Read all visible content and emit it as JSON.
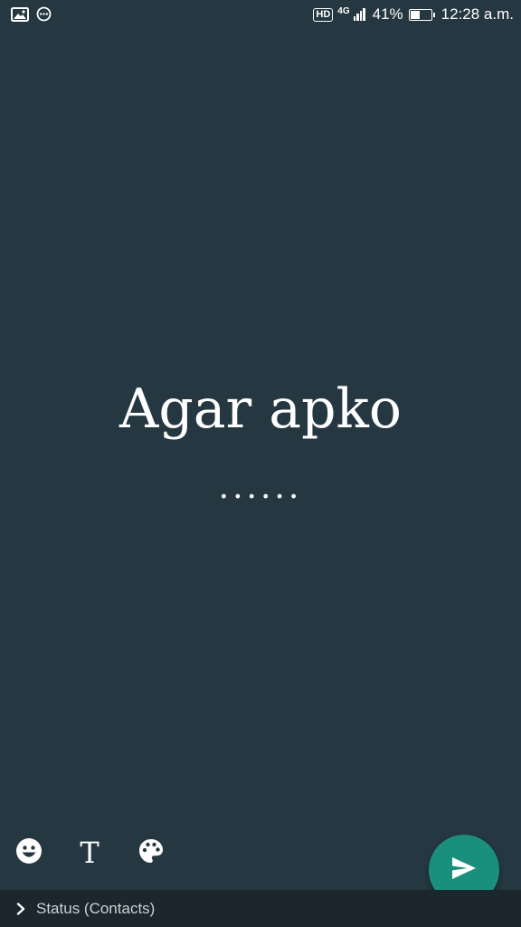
{
  "status_bar": {
    "network_hd": "HD",
    "network_type": "4G",
    "battery_percent_text": "41%",
    "battery_level": 0.41,
    "time": "12:28 a.m.",
    "left_icons": [
      "gallery-icon",
      "more-circle-icon"
    ]
  },
  "status_editor": {
    "text_line1": "Agar apko",
    "text_line2": "......",
    "background_color": "#253740"
  },
  "toolbar": {
    "emoji_icon": "emoji-icon",
    "text_tool_label": "T",
    "palette_icon": "palette-icon",
    "send_icon": "send-icon",
    "send_color": "#1a907c"
  },
  "audience": {
    "label": "Status (Contacts)"
  }
}
